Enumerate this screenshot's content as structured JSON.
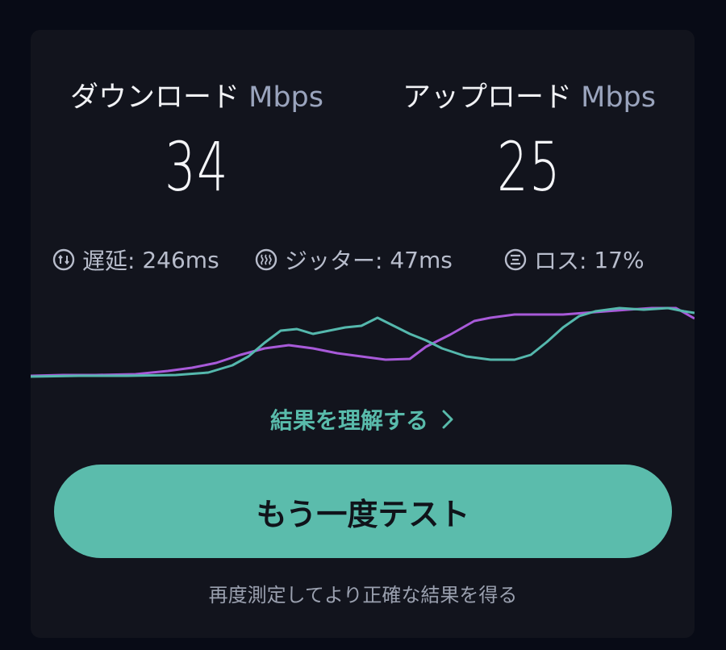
{
  "download": {
    "label": "ダウンロード",
    "unit": "Mbps",
    "value": "34"
  },
  "upload": {
    "label": "アップロード",
    "unit": "Mbps",
    "value": "25"
  },
  "stats": {
    "latency": {
      "label": "遅延:",
      "value": "246ms",
      "icon": "latency-icon"
    },
    "jitter": {
      "label": "ジッター:",
      "value": "47ms",
      "icon": "jitter-icon"
    },
    "loss": {
      "label": "ロス:",
      "value": "17%",
      "icon": "loss-icon"
    }
  },
  "understand_link": {
    "label": "結果を理解する",
    "icon": "chevron-right-icon"
  },
  "retest_button": {
    "label": "もう一度テスト"
  },
  "hint_text": "再度測定してより正確な結果を得る",
  "colors": {
    "background": "#080b16",
    "card": "#12141d",
    "download_line": "#a85ad9",
    "upload_line": "#55b8ad",
    "accent": "#5bbcac"
  }
}
